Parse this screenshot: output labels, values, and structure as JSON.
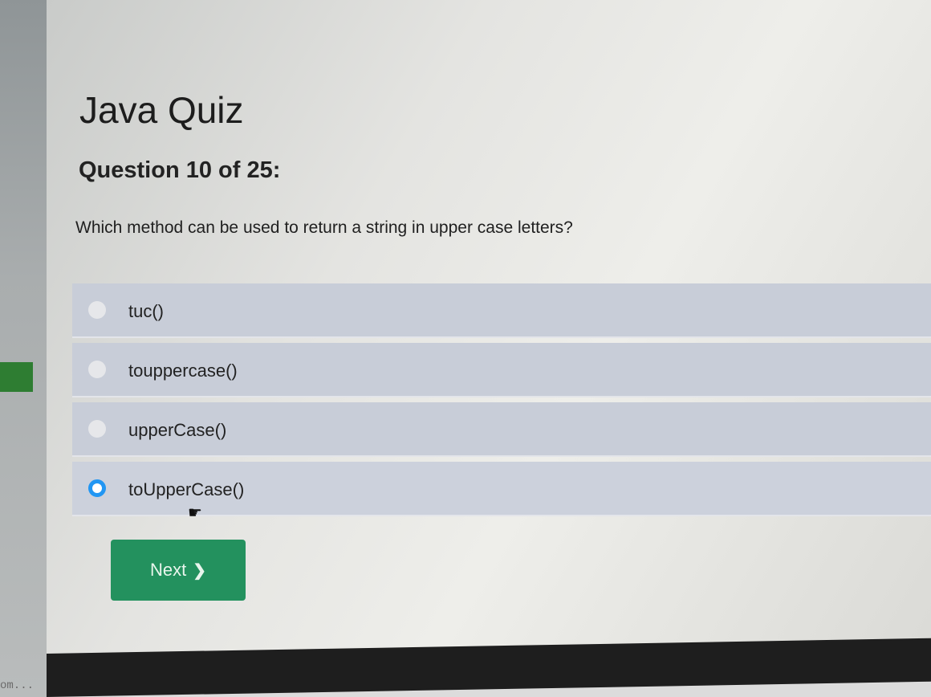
{
  "left_gutter": {
    "url_fragment": "om..."
  },
  "quiz": {
    "title": "Java Quiz",
    "counter": "Question 10 of 25:",
    "question": "Which method can be used to return a string in upper case letters?"
  },
  "options": [
    {
      "label": "tuc()",
      "selected": false
    },
    {
      "label": "touppercase()",
      "selected": false
    },
    {
      "label": "upperCase()",
      "selected": false
    },
    {
      "label": "toUpperCase()",
      "selected": true
    }
  ],
  "next_button": {
    "label": "Next",
    "icon": "chevron-right-icon"
  },
  "colors": {
    "accent_green": "#23915e",
    "radio_selected": "#2196f3",
    "option_background": "#c8cdd8"
  }
}
